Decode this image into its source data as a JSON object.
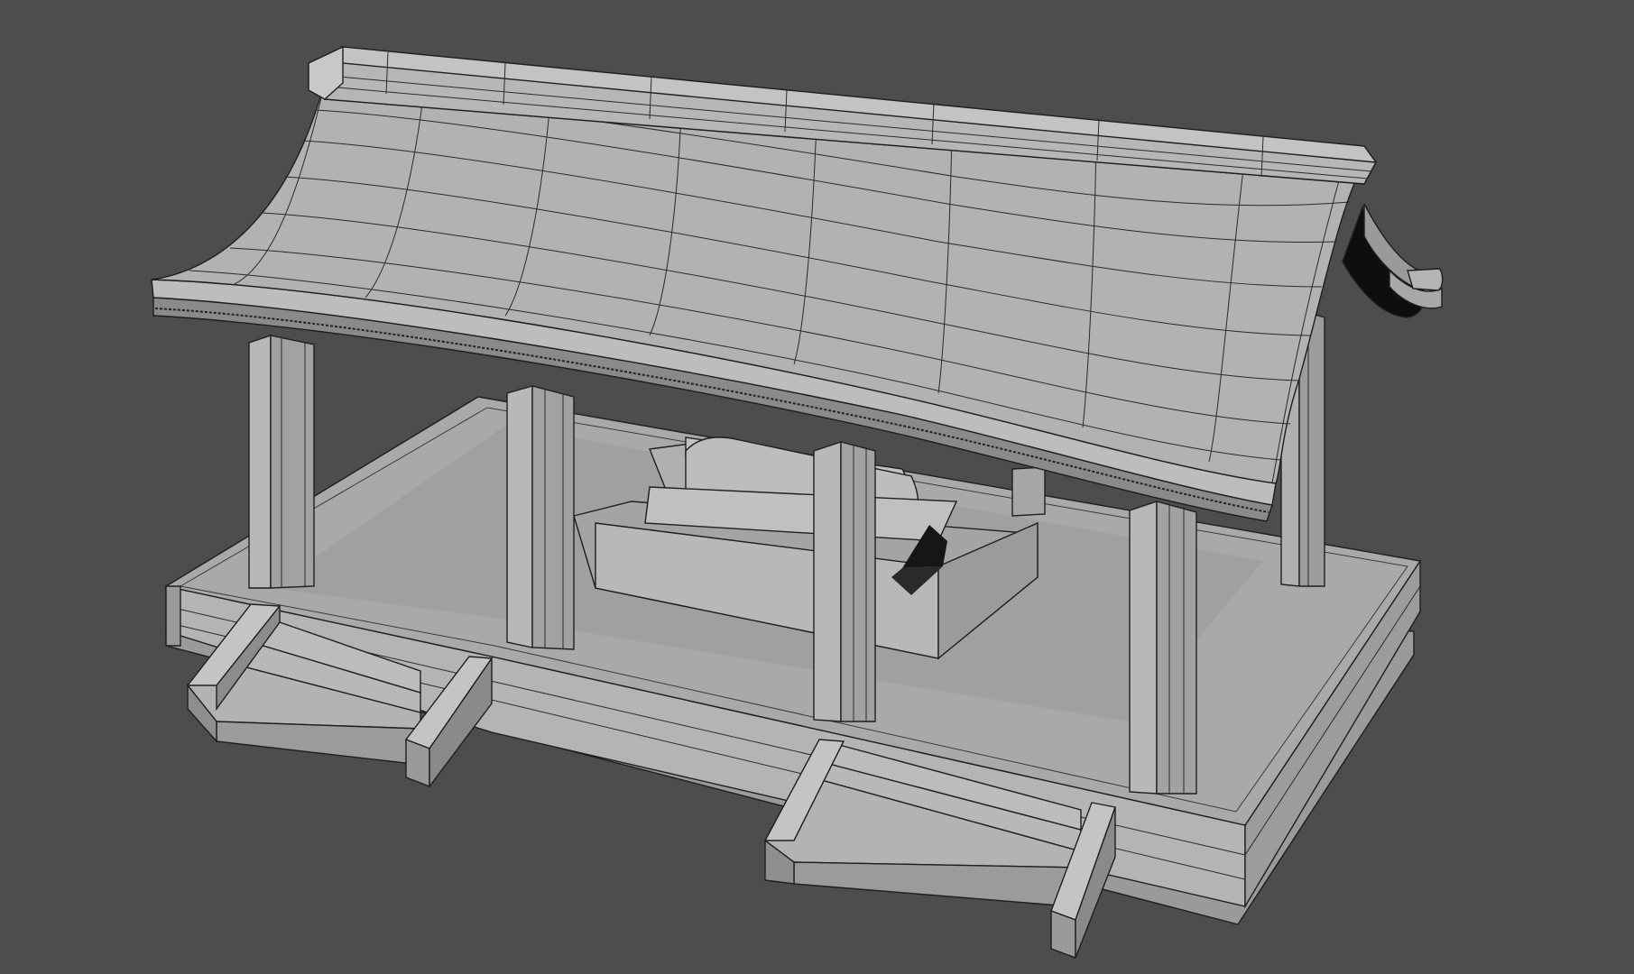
{
  "viewport": {
    "background": "#4d4d4d",
    "shading": "gray-clay-with-wireframe"
  },
  "colors": {
    "surface_light": "#b9b9b9",
    "surface_mid": "#a6a6a6",
    "surface_shadow": "#8a8a8a",
    "surface_dark": "#6e6e6e",
    "wire": "#2a2a2a",
    "cavity": "#0e0e0e"
  },
  "model": {
    "name": "shrine-pavilion",
    "parts": [
      "roof",
      "ridge",
      "eave-trim",
      "columns",
      "platform",
      "stairs",
      "altar-box",
      "roof-end-ornament"
    ]
  }
}
